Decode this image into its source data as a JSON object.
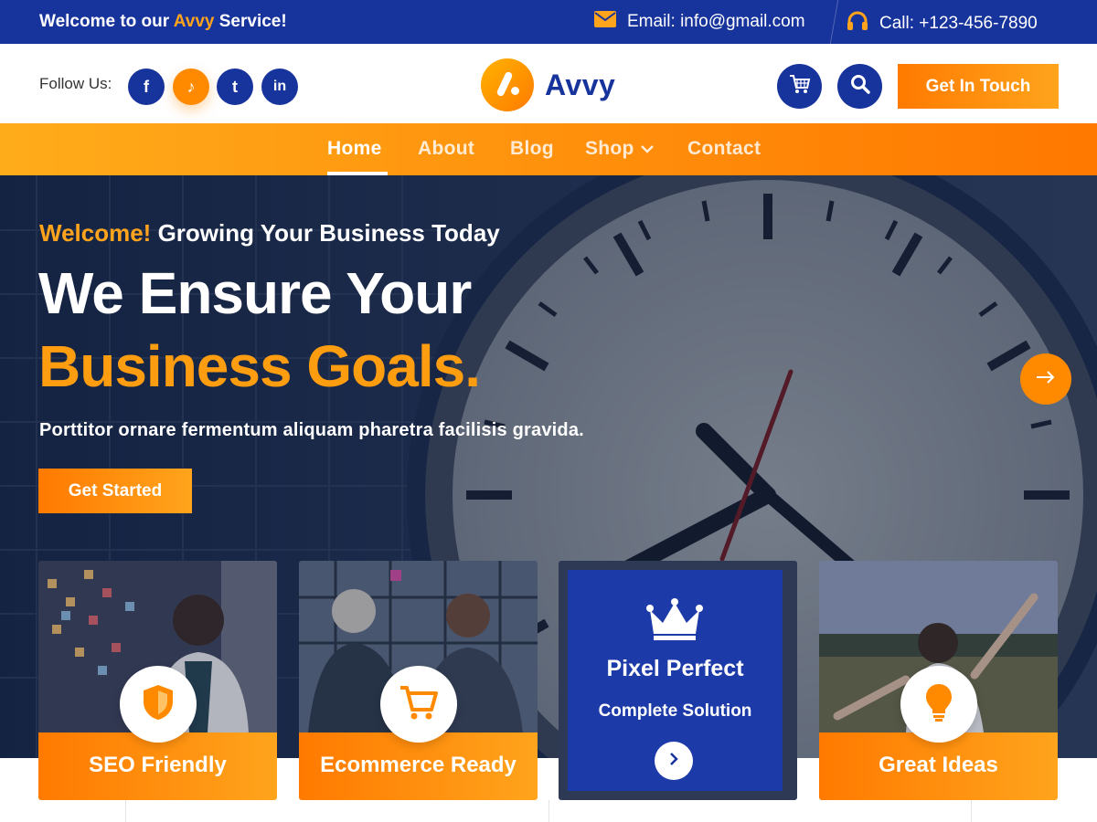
{
  "topbar": {
    "welcome_prefix": "Welcome to our ",
    "welcome_brand": "Avvy",
    "welcome_suffix": " Service!",
    "email": "Email: info@gmail.com",
    "call": "Call: +123-456-7890",
    "icons": {
      "email": "envelope-icon",
      "call": "headphones-icon"
    }
  },
  "header": {
    "follow_label": "Follow Us:",
    "social": [
      {
        "name": "facebook",
        "glyph": "f"
      },
      {
        "name": "tiktok",
        "glyph": "♪"
      },
      {
        "name": "twitter",
        "glyph": "t"
      },
      {
        "name": "linkedin",
        "glyph": "in"
      }
    ],
    "logo_text": "Avvy",
    "cta": "Get In Touch",
    "icons": {
      "cart": "cart-icon",
      "search": "search-icon"
    }
  },
  "nav": {
    "items": [
      "Home",
      "About",
      "Blog",
      "Shop",
      "Contact"
    ],
    "active": "Home"
  },
  "hero": {
    "subhead_accent": "Welcome!",
    "subhead_rest": " Growing Your Business Today",
    "title_line1": "We Ensure Your",
    "title_line2": "Business Goals.",
    "lead": "Porttitor ornare fermentum aliquam pharetra facilisis gravida.",
    "cta": "Get Started"
  },
  "features": [
    {
      "title": "SEO Friendly",
      "icon": "shield-icon"
    },
    {
      "title": "Ecommerce Ready",
      "icon": "cart-icon"
    },
    {
      "title": "Pixel Perfect",
      "subtitle": "Complete Solution",
      "icon": "crown-icon"
    },
    {
      "title": "Great Ideas",
      "icon": "lightbulb-icon"
    }
  ],
  "colors": {
    "primary_blue": "#17339c",
    "accent_orange": "#ff8a00",
    "accent_light": "#ffa41c"
  }
}
